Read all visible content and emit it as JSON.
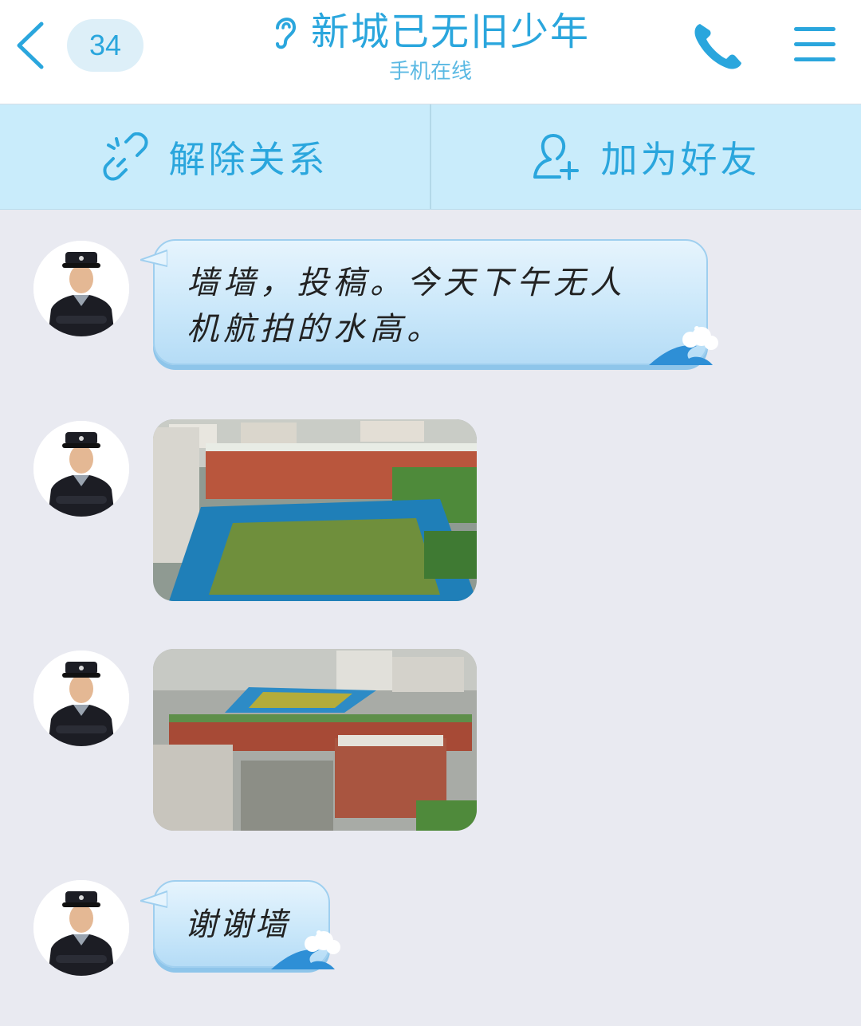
{
  "header": {
    "unread_count": "34",
    "contact_name": "新城已无旧少年",
    "contact_status": "手机在线",
    "icons": [
      "back-chevron-icon",
      "ear-icon",
      "phone-icon",
      "menu-icon"
    ]
  },
  "actions": {
    "unlink_label": "解除关系",
    "add_friend_label": "加为好友",
    "icons": [
      "unlink-icon",
      "add-friend-icon"
    ]
  },
  "messages": [
    {
      "type": "text",
      "lines": [
        "墙墙，投稿。今天下午无人",
        "机航拍的水高。"
      ]
    },
    {
      "type": "image",
      "subject": "aerial-school-field"
    },
    {
      "type": "image",
      "subject": "aerial-school-buildings"
    },
    {
      "type": "text",
      "lines": [
        "谢谢墙"
      ]
    }
  ],
  "colors": {
    "accent": "#2aa6dd",
    "header_bg": "#ffffff",
    "action_bar_bg": "#c9ecfb",
    "chat_bg": "#e9eaf1",
    "bubble_bg": "#cbe8fa"
  }
}
